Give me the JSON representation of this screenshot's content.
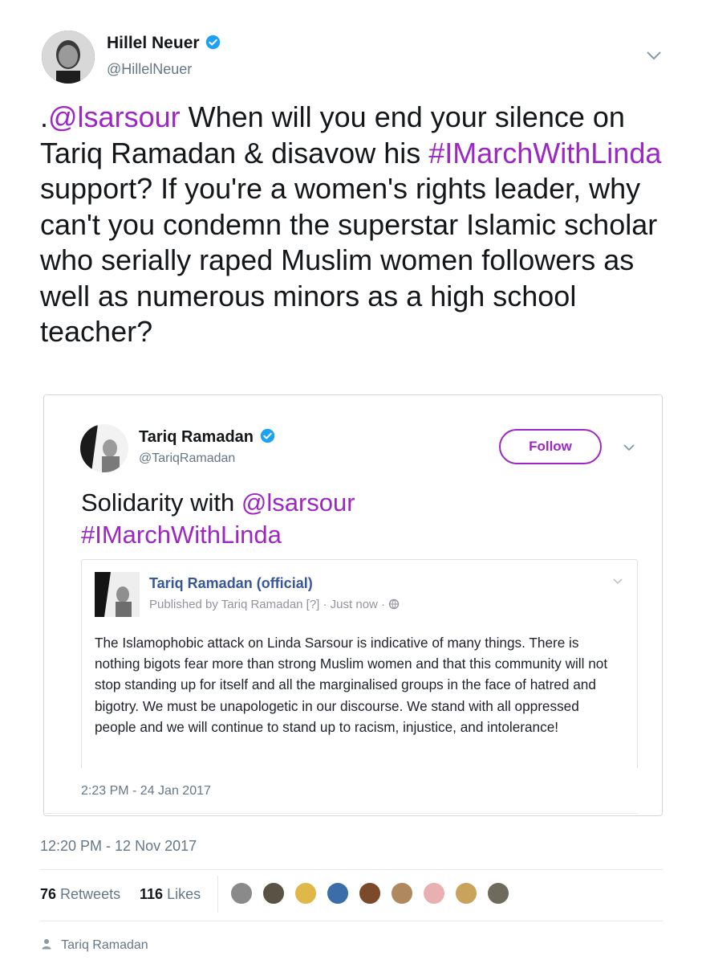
{
  "author": {
    "name": "Hillel Neuer",
    "handle": "@HillelNeuer"
  },
  "tweet": {
    "mention_prefix": ".",
    "mention": "@lsarsour",
    "text_1": " When will you end your silence on Tariq Ramadan & disavow his ",
    "hashtag": "#IMarchWithLinda",
    "text_2": " support? If you're a women's rights leader, why can't you condemn the superstar Islamic scholar who serially raped Muslim women followers as well as numerous minors as a high school teacher?",
    "timestamp": "12:20 PM - 12 Nov 2017"
  },
  "quoted": {
    "name": "Tariq Ramadan",
    "handle": "@TariqRamadan",
    "follow_label": "Follow",
    "text_1": "Solidarity with ",
    "mention": "@lsarsour",
    "hashtag": "#IMarchWithLinda",
    "timestamp": "2:23 PM - 24 Jan 2017",
    "fb_post": {
      "page_name": "Tariq Ramadan (official)",
      "meta": "Published by Tariq Ramadan [?] · Just now ·",
      "body": "The Islamophobic attack on Linda Sarsour is indicative of many things. There is nothing bigots fear more than strong Muslim women and that this community will not stop standing up for itself and all the marginalised groups in the face of hatred and bigotry. We must be unapologetic in our discourse. We stand with all oppressed people and we will continue to stand up to racism, injustice, and intolerance!"
    }
  },
  "stats": {
    "retweets_count": "76",
    "retweets_label": "Retweets",
    "likes_count": "116",
    "likes_label": "Likes"
  },
  "footer": {
    "related_user": "Tariq Ramadan"
  },
  "colors": {
    "accent": "#9c27c2",
    "verified": "#1da1f2",
    "muted": "#657786",
    "facebook_link": "#365899"
  },
  "icons": [
    "verified-badge-icon",
    "chevron-down-icon",
    "globe-icon",
    "person-icon"
  ]
}
